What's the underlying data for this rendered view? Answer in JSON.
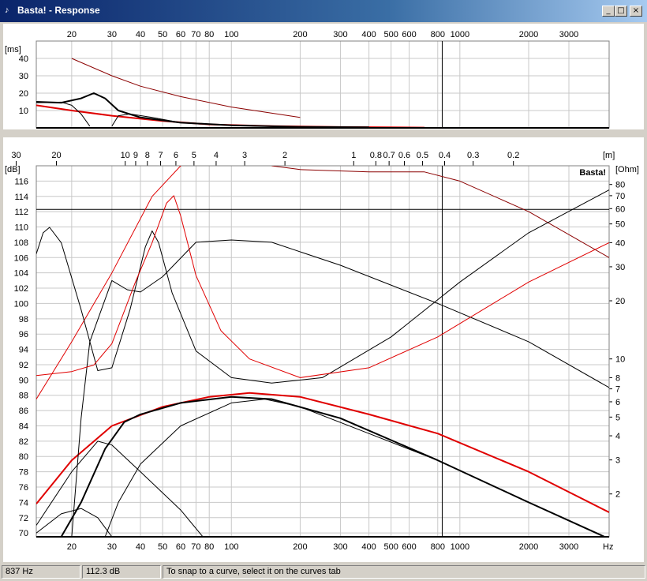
{
  "window": {
    "title": "Basta! - Response",
    "minimize_glyph": "_",
    "maximize_glyph": "□",
    "close_glyph": "×"
  },
  "status": {
    "frequency": "837 Hz",
    "level": "112.3 dB",
    "hint": "To snap to a curve, select it on the curves tab"
  },
  "colors": {
    "red": "#e00000",
    "darkred": "#8b0000",
    "black": "#000000",
    "grid": "#c8c8c8"
  },
  "chart_data": [
    {
      "type": "line",
      "name_label": "",
      "ylabel": "[ms]",
      "x_scale": "log",
      "xlim": [
        14,
        4500
      ],
      "ylim": [
        0,
        50
      ],
      "x_ticks": [
        "20",
        "30",
        "40",
        "50",
        "60",
        "70",
        "80",
        "100",
        "200",
        "300",
        "400",
        "500",
        "600",
        "800",
        "1000",
        "2000",
        "3000"
      ],
      "x_tick_values": [
        20,
        30,
        40,
        50,
        60,
        70,
        80,
        100,
        200,
        300,
        400,
        500,
        600,
        800,
        1000,
        2000,
        3000
      ],
      "y_ticks": [
        "10",
        "20",
        "30",
        "40"
      ],
      "y_tick_values": [
        10,
        20,
        30,
        40
      ],
      "cursor_x": 837,
      "series": [
        {
          "color": "darkred",
          "width": 1,
          "points": [
            [
              20,
              40
            ],
            [
              30,
              30
            ],
            [
              40,
              24
            ],
            [
              60,
              18
            ],
            [
              100,
              12
            ],
            [
              200,
              6
            ]
          ]
        },
        {
          "color": "red",
          "width": 2,
          "points": [
            [
              14,
              13
            ],
            [
              20,
              10
            ],
            [
              30,
              7
            ],
            [
              50,
              4
            ],
            [
              80,
              2
            ],
            [
              150,
              1
            ],
            [
              300,
              0.5
            ],
            [
              700,
              0.2
            ]
          ]
        },
        {
          "color": "black",
          "width": 2,
          "points": [
            [
              14,
              15
            ],
            [
              18,
              14.5
            ],
            [
              22,
              17
            ],
            [
              25,
              20
            ],
            [
              28,
              17
            ],
            [
              32,
              10
            ],
            [
              40,
              6
            ],
            [
              60,
              3
            ],
            [
              100,
              1.5
            ],
            [
              200,
              0.6
            ],
            [
              400,
              0.3
            ]
          ]
        },
        {
          "color": "black",
          "width": 1,
          "points": [
            [
              14,
              14.5
            ],
            [
              18,
              14.8
            ],
            [
              20,
              13
            ],
            [
              22,
              8
            ],
            [
              24,
              1
            ]
          ]
        },
        {
          "color": "black",
          "width": 1,
          "points": [
            [
              30,
              1
            ],
            [
              32,
              7
            ],
            [
              36,
              8
            ],
            [
              45,
              6
            ],
            [
              60,
              3
            ],
            [
              100,
              1.5
            ]
          ]
        }
      ]
    },
    {
      "type": "line",
      "ylabel": "[dB]",
      "y2label": "[Ohm]",
      "top_axis_label": "[m]",
      "bottom_axis_unit": "Hz",
      "watermark": "Basta!",
      "x_scale": "log",
      "xlim": [
        14,
        4500
      ],
      "ylim": [
        69.5,
        118
      ],
      "y2_scale": "log",
      "y2lim": [
        1.2,
        100
      ],
      "x_ticks": [
        "20",
        "30",
        "40",
        "50",
        "60",
        "70",
        "80",
        "100",
        "200",
        "300",
        "400",
        "500",
        "600",
        "800",
        "1000",
        "2000",
        "3000"
      ],
      "x_tick_values": [
        20,
        30,
        40,
        50,
        60,
        70,
        80,
        100,
        200,
        300,
        400,
        500,
        600,
        800,
        1000,
        2000,
        3000
      ],
      "top_ticks": [
        "30",
        "20",
        "10",
        "9",
        "8",
        "7",
        "6",
        "5",
        "4",
        "3",
        "2",
        "1",
        "0.8",
        "0.7",
        "0.6",
        "0.5",
        "0.4",
        "0.3",
        "0.2"
      ],
      "top_tick_values": [
        30,
        20,
        10,
        9,
        8,
        7,
        6,
        5,
        4,
        3,
        2,
        1,
        0.8,
        0.7,
        0.6,
        0.5,
        0.4,
        0.3,
        0.2
      ],
      "y_ticks": [
        "70",
        "72",
        "74",
        "76",
        "78",
        "80",
        "82",
        "84",
        "86",
        "88",
        "90",
        "92",
        "94",
        "96",
        "98",
        "100",
        "102",
        "104",
        "106",
        "108",
        "110",
        "112",
        "114",
        "116"
      ],
      "y_tick_values": [
        70,
        72,
        74,
        76,
        78,
        80,
        82,
        84,
        86,
        88,
        90,
        92,
        94,
        96,
        98,
        100,
        102,
        104,
        106,
        108,
        110,
        112,
        114,
        116
      ],
      "y2_ticks": [
        "2",
        "3",
        "4",
        "5",
        "6",
        "7",
        "8",
        "10",
        "20",
        "30",
        "40",
        "50",
        "60",
        "70",
        "80"
      ],
      "y2_tick_values": [
        2,
        3,
        4,
        5,
        6,
        7,
        8,
        10,
        20,
        30,
        40,
        50,
        60,
        70,
        80
      ],
      "cursor_x": 837,
      "cursor_y": 112.3,
      "series": [
        {
          "axis": "left",
          "color": "red",
          "width": 2,
          "points": [
            [
              14,
              73.8
            ],
            [
              20,
              79.5
            ],
            [
              30,
              84
            ],
            [
              50,
              86.5
            ],
            [
              80,
              87.8
            ],
            [
              120,
              88.3
            ],
            [
              200,
              87.8
            ],
            [
              400,
              85.5
            ],
            [
              800,
              83
            ],
            [
              2000,
              78
            ],
            [
              4500,
              72.7
            ]
          ]
        },
        {
          "axis": "left",
          "color": "black",
          "width": 2,
          "points": [
            [
              18,
              69.5
            ],
            [
              22,
              74
            ],
            [
              28,
              81
            ],
            [
              34,
              84.5
            ],
            [
              40,
              85.5
            ],
            [
              60,
              87
            ],
            [
              100,
              87.8
            ],
            [
              150,
              87.5
            ],
            [
              300,
              85
            ],
            [
              800,
              79.5
            ],
            [
              2000,
              74
            ],
            [
              4300,
              69.5
            ]
          ]
        },
        {
          "axis": "left",
          "color": "black",
          "width": 1,
          "points": [
            [
              14,
              70
            ],
            [
              18,
              72.5
            ],
            [
              22,
              73.2
            ],
            [
              26,
              72
            ],
            [
              30,
              69.5
            ]
          ]
        },
        {
          "axis": "left",
          "color": "black",
          "width": 1,
          "points": [
            [
              14,
              71
            ],
            [
              20,
              78
            ],
            [
              26,
              82
            ],
            [
              30,
              81.5
            ],
            [
              40,
              78
            ],
            [
              60,
              73
            ],
            [
              75,
              69.5
            ]
          ]
        },
        {
          "axis": "left",
          "color": "black",
          "width": 1,
          "points": [
            [
              28,
              69.5
            ],
            [
              32,
              74
            ],
            [
              40,
              79
            ],
            [
              60,
              84
            ],
            [
              100,
              87
            ],
            [
              140,
              87.5
            ],
            [
              200,
              86.5
            ],
            [
              400,
              83
            ],
            [
              800,
              79.5
            ],
            [
              2000,
              74
            ],
            [
              4300,
              69.5
            ]
          ]
        },
        {
          "axis": "left",
          "color": "black",
          "width": 1,
          "points": [
            [
              20,
              69.5
            ],
            [
              22,
              85
            ],
            [
              24,
              95
            ],
            [
              30,
              103
            ],
            [
              35,
              101.8
            ],
            [
              40,
              101.5
            ],
            [
              50,
              103.5
            ],
            [
              70,
              108
            ],
            [
              100,
              108.3
            ],
            [
              150,
              108
            ],
            [
              300,
              105
            ],
            [
              800,
              100
            ],
            [
              2000,
              95
            ],
            [
              4500,
              89
            ]
          ]
        },
        {
          "axis": "left",
          "color": "red",
          "width": 1,
          "points": [
            [
              14,
              87.5
            ],
            [
              20,
              95
            ],
            [
              30,
              104
            ],
            [
              45,
              114
            ],
            [
              60,
              118
            ],
            [
              75,
              120
            ]
          ]
        },
        {
          "axis": "left",
          "color": "darkred",
          "width": 1,
          "points": [
            [
              150,
              118
            ],
            [
              200,
              117.5
            ],
            [
              400,
              117.2
            ],
            [
              700,
              117.2
            ],
            [
              1000,
              116
            ],
            [
              2000,
              112
            ],
            [
              4500,
              106
            ]
          ]
        },
        {
          "axis": "right",
          "color": "black",
          "width": 1,
          "points": [
            [
              14,
              35
            ],
            [
              15,
              45
            ],
            [
              16,
              48
            ],
            [
              18,
              40
            ],
            [
              22,
              18
            ],
            [
              26,
              8.7
            ],
            [
              30,
              9
            ],
            [
              36,
              18
            ],
            [
              42,
              38
            ],
            [
              45,
              46
            ],
            [
              48,
              40
            ],
            [
              55,
              22
            ],
            [
              70,
              11
            ],
            [
              100,
              8
            ],
            [
              150,
              7.5
            ],
            [
              250,
              8
            ],
            [
              500,
              13
            ],
            [
              1000,
              25
            ],
            [
              2000,
              45
            ],
            [
              4500,
              75
            ]
          ]
        },
        {
          "axis": "right",
          "color": "red",
          "width": 1,
          "points": [
            [
              14,
              8.2
            ],
            [
              20,
              8.6
            ],
            [
              25,
              9.3
            ],
            [
              30,
              12
            ],
            [
              38,
              25
            ],
            [
              45,
              40
            ],
            [
              52,
              64
            ],
            [
              56,
              70
            ],
            [
              60,
              55
            ],
            [
              70,
              27
            ],
            [
              90,
              14
            ],
            [
              120,
              10
            ],
            [
              200,
              8
            ],
            [
              400,
              9
            ],
            [
              800,
              13
            ],
            [
              2000,
              25
            ],
            [
              4500,
              40
            ]
          ]
        }
      ]
    }
  ]
}
